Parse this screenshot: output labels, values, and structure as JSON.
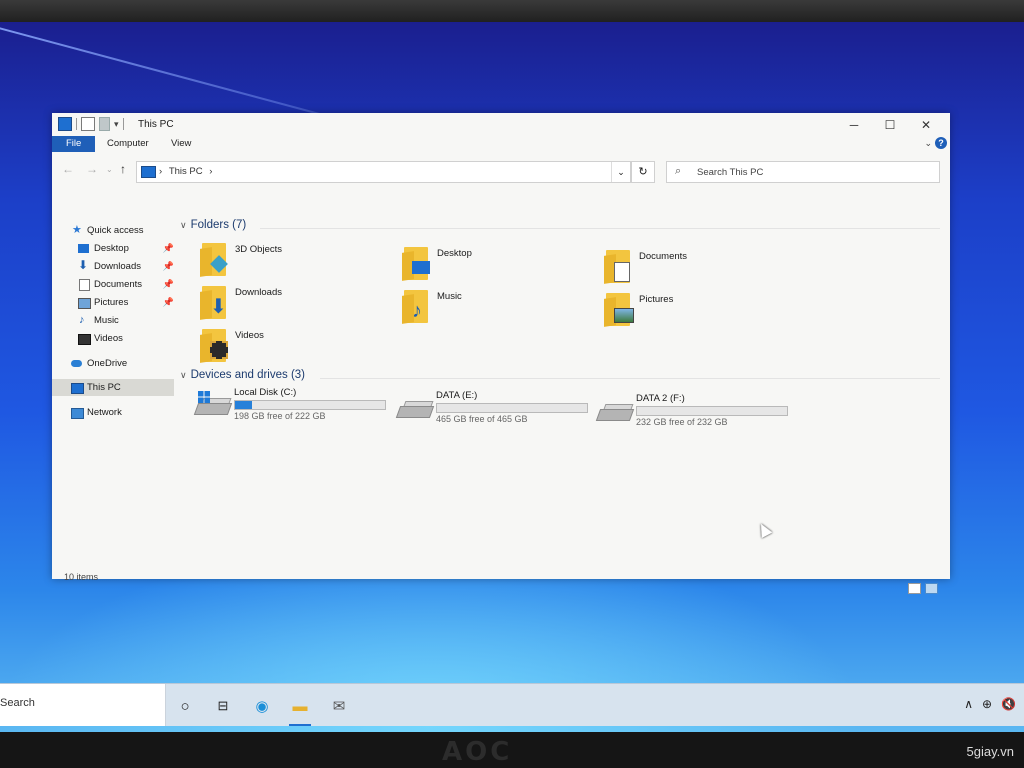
{
  "window": {
    "title": "This PC",
    "controls": [
      "─",
      "☐",
      "✕"
    ]
  },
  "ribbon": {
    "tabs": [
      "File",
      "Computer",
      "View"
    ]
  },
  "address": {
    "crumb_sep": "›",
    "location": "This PC",
    "trailing_sep": "›"
  },
  "search": {
    "placeholder": "Search This PC"
  },
  "sidebar": {
    "items": [
      {
        "label": "Quick access",
        "icon": "star-icon",
        "pinned": false
      },
      {
        "label": "Desktop",
        "icon": "desktop-icon",
        "pinned": true
      },
      {
        "label": "Downloads",
        "icon": "download-arrow-icon",
        "pinned": true
      },
      {
        "label": "Documents",
        "icon": "documents-icon",
        "pinned": true
      },
      {
        "label": "Pictures",
        "icon": "pictures-icon",
        "pinned": true
      },
      {
        "label": "Music",
        "icon": "music-icon",
        "pinned": false
      },
      {
        "label": "Videos",
        "icon": "videos-icon",
        "pinned": false
      },
      {
        "label": "OneDrive",
        "icon": "cloud-icon",
        "pinned": false
      },
      {
        "label": "This PC",
        "icon": "computer-icon",
        "pinned": false,
        "selected": true
      },
      {
        "label": "Network",
        "icon": "network-icon",
        "pinned": false
      }
    ]
  },
  "folders": {
    "heading": "Folders (7)",
    "items": [
      {
        "label": "3D Objects",
        "badge": "cube-icon"
      },
      {
        "label": "Desktop",
        "badge": "desktop-icon"
      },
      {
        "label": "Documents",
        "badge": "documents-icon"
      },
      {
        "label": "Downloads",
        "badge": "download-arrow-icon"
      },
      {
        "label": "Music",
        "badge": "music-icon"
      },
      {
        "label": "Pictures",
        "badge": "pictures-icon"
      },
      {
        "label": "Videos",
        "badge": "videos-icon"
      }
    ]
  },
  "drives": {
    "heading": "Devices and drives (3)",
    "items": [
      {
        "label": "Local Disk (C:)",
        "free": "198 GB free of 222 GB",
        "used_fraction": 0.11,
        "system": true
      },
      {
        "label": "DATA (E:)",
        "free": "465 GB free of 465 GB",
        "used_fraction": 0.0,
        "system": false
      },
      {
        "label": "DATA 2 (F:)",
        "free": "232 GB free of 232 GB",
        "used_fraction": 0.0,
        "system": false
      }
    ]
  },
  "status": {
    "count": "10 items"
  },
  "taskbar": {
    "search_label": "Search"
  },
  "monitor": {
    "brand": "AOC"
  },
  "watermark": "5giay.vn",
  "colors": {
    "accent": "#1f5fb8",
    "drive_fill": "#2680d9",
    "folder": "#f3c53f"
  }
}
